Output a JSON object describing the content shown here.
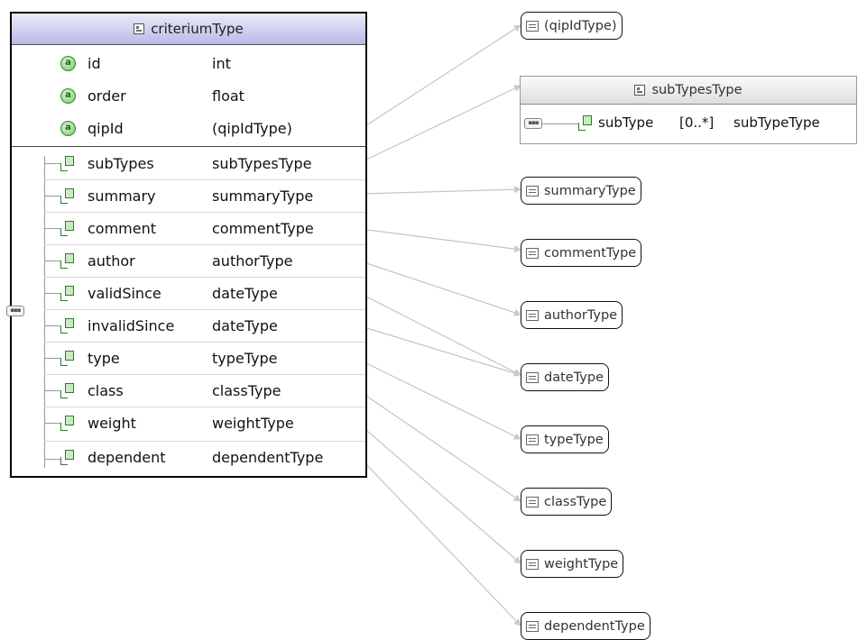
{
  "main_type": {
    "title": "criteriumType",
    "attributes": [
      {
        "name": "id",
        "type": "int"
      },
      {
        "name": "order",
        "type": "float"
      },
      {
        "name": "qipId",
        "type": "(qipIdType)"
      }
    ],
    "elements": [
      {
        "name": "subTypes",
        "type": "subTypesType"
      },
      {
        "name": "summary",
        "type": "summaryType"
      },
      {
        "name": "comment",
        "type": "commentType"
      },
      {
        "name": "author",
        "type": "authorType"
      },
      {
        "name": "validSince",
        "type": "dateType"
      },
      {
        "name": "invalidSince",
        "type": "dateType"
      },
      {
        "name": "type",
        "type": "typeType"
      },
      {
        "name": "class",
        "type": "classType"
      },
      {
        "name": "weight",
        "type": "weightType"
      },
      {
        "name": "dependent",
        "type": "dependentType"
      }
    ],
    "sequence_glyph": "▪▪▪"
  },
  "sub_types_type": {
    "title": "subTypesType",
    "element_name": "subType",
    "multiplicity": "[0..*]",
    "element_type": "subTypeType"
  },
  "simple_types": [
    {
      "label": "(qipIdType)"
    },
    {
      "label": "summaryType"
    },
    {
      "label": "commentType"
    },
    {
      "label": "authorType"
    },
    {
      "label": "dateType"
    },
    {
      "label": "typeType"
    },
    {
      "label": "classType"
    },
    {
      "label": "weightType"
    },
    {
      "label": "dependentType"
    }
  ],
  "colors": {
    "header_gradient_top": "#ebebf9",
    "header_gradient_bottom": "#b9b9e8",
    "connector_line": "#c4c4c4",
    "attribute_icon": "#2e8b2e"
  }
}
